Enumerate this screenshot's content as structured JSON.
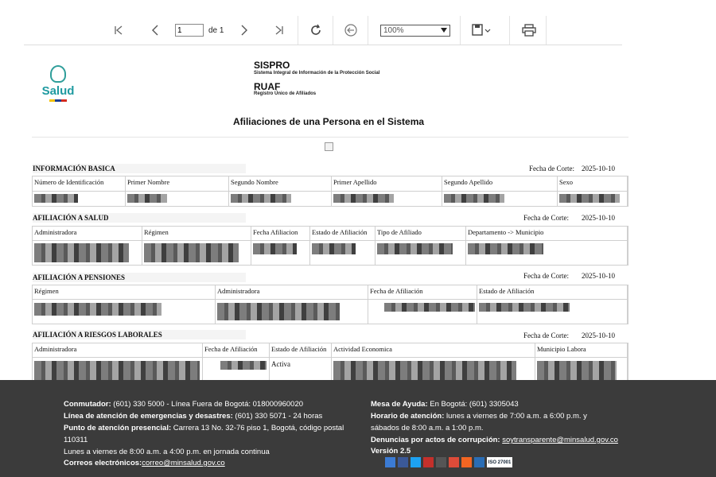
{
  "toolbar": {
    "page_value": "1",
    "of_label": "de 1",
    "zoom_value": "100%",
    "icons": [
      "first-page-icon",
      "prev-page-icon",
      "next-page-icon",
      "last-page-icon",
      "refresh-icon",
      "back-icon",
      "save-icon",
      "print-icon"
    ]
  },
  "header": {
    "logo_text": "Salud",
    "sispro_title": "SISPRO",
    "sispro_sub": "Sistema Integral de Información de la Protección Social",
    "ruaf_title": "RUAF",
    "ruaf_sub": "Registro Único de Afiliados",
    "report_title": "Afiliaciones de una Persona en el Sistema"
  },
  "basic": {
    "title": "INFORMACIÓN BASICA",
    "cut_label": "Fecha de Corte:",
    "cut_value": "2025-10-10",
    "columns": [
      "Número de Identificación",
      "Primer Nombre",
      "Segundo Nombre",
      "Primer Apellido",
      "Segundo Apellido",
      "Sexo"
    ]
  },
  "salud": {
    "title": "AFILIACIÓN A SALUD",
    "cut_label": "Fecha de Corte:",
    "cut_value": "2025-10-10",
    "columns": [
      "Administradora",
      "Régimen",
      "Fecha Afiliacion",
      "Estado de Afiliación",
      "Tipo de Afiliado",
      "Departamento -> Municipio"
    ]
  },
  "pensiones": {
    "title": "AFILIACIÓN A PENSIONES",
    "cut_label": "Fecha de Corte:",
    "cut_value": "2025-10-10",
    "columns": [
      "Régimen",
      "Administradora",
      "Fecha de Afiliación",
      "Estado de Afiliación"
    ]
  },
  "riesgos": {
    "title": "AFILIACIÓN A RIESGOS LABORALES",
    "cut_label": "Fecha de Corte:",
    "cut_value": "2025-10-10",
    "columns": [
      "Administradora",
      "Fecha de Afiliación",
      "Estado de Afiliación",
      "Actividad Economica",
      "Municipio Labora"
    ],
    "estado": "Activa"
  },
  "footer": {
    "conmutador_label": "Conmutador:",
    "conmutador_text": " (601) 330 5000 - Línea Fuera de Bogotá: 018000960020",
    "emergencias_label": "Línea de atención de emergencias y desastres:",
    "emergencias_text": " (601) 330 5071 - 24 horas",
    "punto_label": "Punto de atención presencial:",
    "punto_text": " Carrera 13 No. 32-76 piso 1, Bogotá, código postal",
    "punto_text2": "110311",
    "horario_punto": "Lunes a viernes de 8:00 a.m. a 4:00 p.m. en jornada continua",
    "correos_label": "Correos electrónicos:",
    "correos_link": "correo@minsalud.gov.co",
    "mesa_label": "Mesa de Ayuda:",
    "mesa_text": " En Bogotá: (601) 3305043",
    "horario_label": "Horario de atención:",
    "horario_text": " lunes a viernes de 7:00 a.m. a 6:00 p.m. y",
    "horario_text2": "sábados de 8:00 a.m. a 1:00 p.m.",
    "denuncias_label": "Denuncias por actos de corrupción:",
    "denuncias_link": "soytransparente@minsalud.gov.co",
    "version": "Versión 2.5",
    "iso_text": "ISO 27001",
    "social_colors": [
      "#3b7bd4",
      "#3b5998",
      "#1da1f2",
      "#c4302b",
      "#555555",
      "#dd4b39",
      "#f26522",
      "#2a6db5"
    ]
  }
}
